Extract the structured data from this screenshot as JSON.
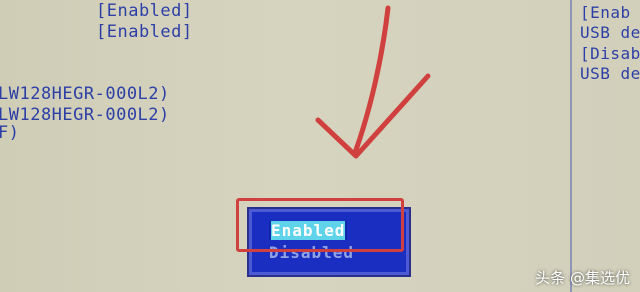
{
  "bios": {
    "options": [
      "[Enabled]",
      "[Enabled]"
    ],
    "devices": [
      "LW128HEGR-000L2)",
      "LW128HEGR-000L2)",
      "F)"
    ],
    "help_panel": [
      "[Enab",
      "USB de",
      "[Disab",
      "USB de"
    ]
  },
  "popup": {
    "selected_label": "Enabled",
    "other_label": "Disabled"
  },
  "colors": {
    "bios_text": "#2c3fa6",
    "popup_bg": "#1a2ec2",
    "annotation_red": "#d0403e"
  },
  "watermark": "头条 @集选优"
}
